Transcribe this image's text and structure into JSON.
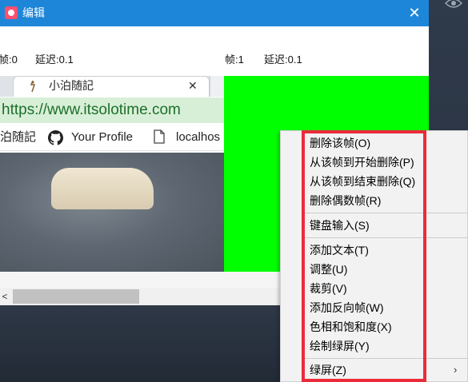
{
  "window": {
    "title": "编辑",
    "close_glyph": "✕",
    "accent": "#1e86d8"
  },
  "frames": [
    {
      "frame_label": "帧:0",
      "delay_label": "延迟:0.1"
    },
    {
      "frame_label": "帧:1",
      "delay_label": "延迟:0.1"
    }
  ],
  "browser": {
    "tab_title": "小泊随記",
    "tab_close": "✕",
    "tab_arrow": "‹",
    "url": "https://www.itsolotime.com",
    "bookmarks": [
      {
        "label": "泊随記"
      },
      {
        "label": "Your Profile",
        "icon": "github-icon"
      },
      {
        "label": "localhos",
        "icon": "document-icon"
      }
    ]
  },
  "scrollbar": {
    "left_arrow": "<"
  },
  "context_menu": {
    "groups": [
      [
        "删除该帧(O)",
        "从该帧到开始删除(P)",
        "从该帧到结束删除(Q)",
        "删除偶数帧(R)"
      ],
      [
        "键盘输入(S)"
      ],
      [
        "添加文本(T)",
        "调整(U)",
        "裁剪(V)",
        "添加反向帧(W)",
        "色相和饱和度(X)",
        "绘制绿屏(Y)"
      ],
      [
        "绿屏(Z)"
      ]
    ],
    "submenu_arrow": "›",
    "highlight_color": "#ec2b3a"
  },
  "colors": {
    "green_frame": "#00ff00",
    "url_green": "#1d6f2a"
  }
}
